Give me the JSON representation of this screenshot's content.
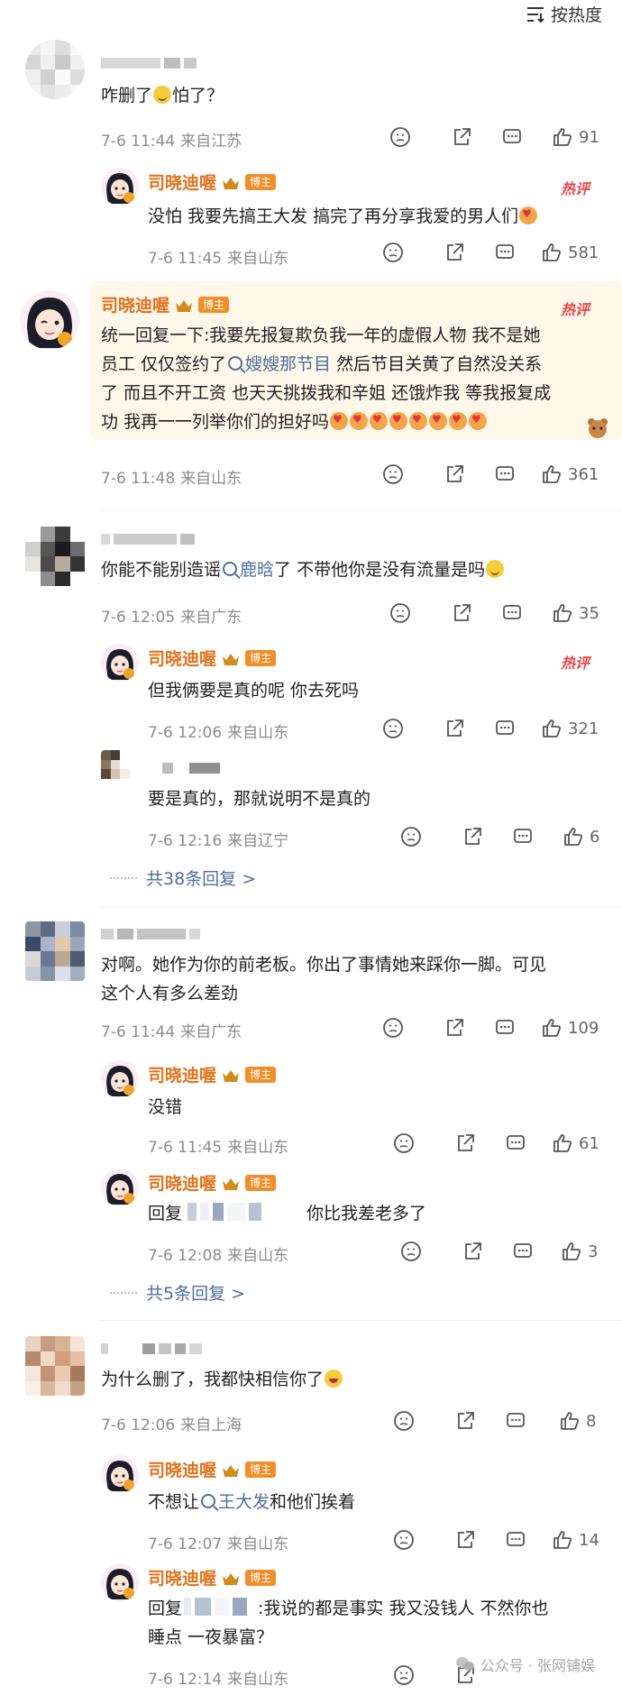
{
  "sort": {
    "label": "按热度"
  },
  "colors": {
    "author": "#e2731d",
    "link": "#4e6e9e",
    "meta": "#8c8c8c",
    "hot": "#e7484e",
    "badge": "#f08f2a"
  },
  "author": {
    "name": "司晓迪喔",
    "badge": "博主",
    "hot_label": "热评"
  },
  "comments": [
    {
      "text": "咋删了",
      "text2": "怕了？",
      "date": "7-6 11:44",
      "loc": "来自江苏",
      "likes": "91",
      "replies": [
        {
          "text": "没怕 我要先搞王大发 搞完了再分享我爱的男人们",
          "date": "7-6 11:45",
          "loc": "来自山东",
          "likes": "581"
        }
      ]
    },
    {
      "lines": [
        "统一回复一下:我要先报复欺负我一年的虚假人物 我不是她",
        "员工 仅仅签约了",
        "嫂嫂那节目",
        " 然后节目关黄了自然没关系",
        "了 而且不开工资 也天天挑拨我和辛姐 还饿炸我 等我报复成",
        "功 我再一一列举你们的担好吗"
      ],
      "date": "7-6 11:48",
      "loc": "来自山东",
      "likes": "361"
    },
    {
      "text": "你能不能别造谣",
      "link": "鹿晗",
      "text2": "了 不带他你是没有流量是吗",
      "date": "7-6 12:05",
      "loc": "来自广东",
      "likes": "35",
      "replies": [
        {
          "text": "但我俩要是真的呢 你去死吗",
          "date": "7-6 12:06",
          "loc": "来自山东",
          "likes": "321"
        },
        {
          "text": "要是真的，那就说明不是真的",
          "date": "7-6 12:16",
          "loc": "来自辽宁",
          "likes": "6"
        }
      ],
      "more": "共38条回复 >"
    },
    {
      "line1": "对啊。她作为你的前老板。你出了事情她来踩你一脚。可见",
      "line2": "这个人有多么差劲",
      "date": "7-6 11:44",
      "loc": "来自广东",
      "likes": "109",
      "replies": [
        {
          "text": "没错",
          "date": "7-6 11:45",
          "loc": "来自山东",
          "likes": "61"
        },
        {
          "prefix": "回复",
          "text": "你比我差老多了",
          "date": "7-6 12:08",
          "loc": "来自山东",
          "likes": "3"
        }
      ],
      "more": "共5条回复 >"
    },
    {
      "text": "为什么删了，我都快相信你了",
      "date": "7-6 12:06",
      "loc": "来自上海",
      "likes": "8",
      "replies": [
        {
          "pre": "不想让",
          "link": "王大发",
          "post": "和他们挨着",
          "date": "7-6 12:07",
          "loc": "来自山东",
          "likes": "14"
        },
        {
          "prefix": "回复",
          "line1": ":我说的都是事实 我又没钱人 不然你也",
          "line2": "睡点 一夜暴富？",
          "date": "7-6 12:14",
          "loc": "来自山东"
        }
      ]
    }
  ],
  "watermark": {
    "label": "公众号 · 张网铺娱"
  }
}
